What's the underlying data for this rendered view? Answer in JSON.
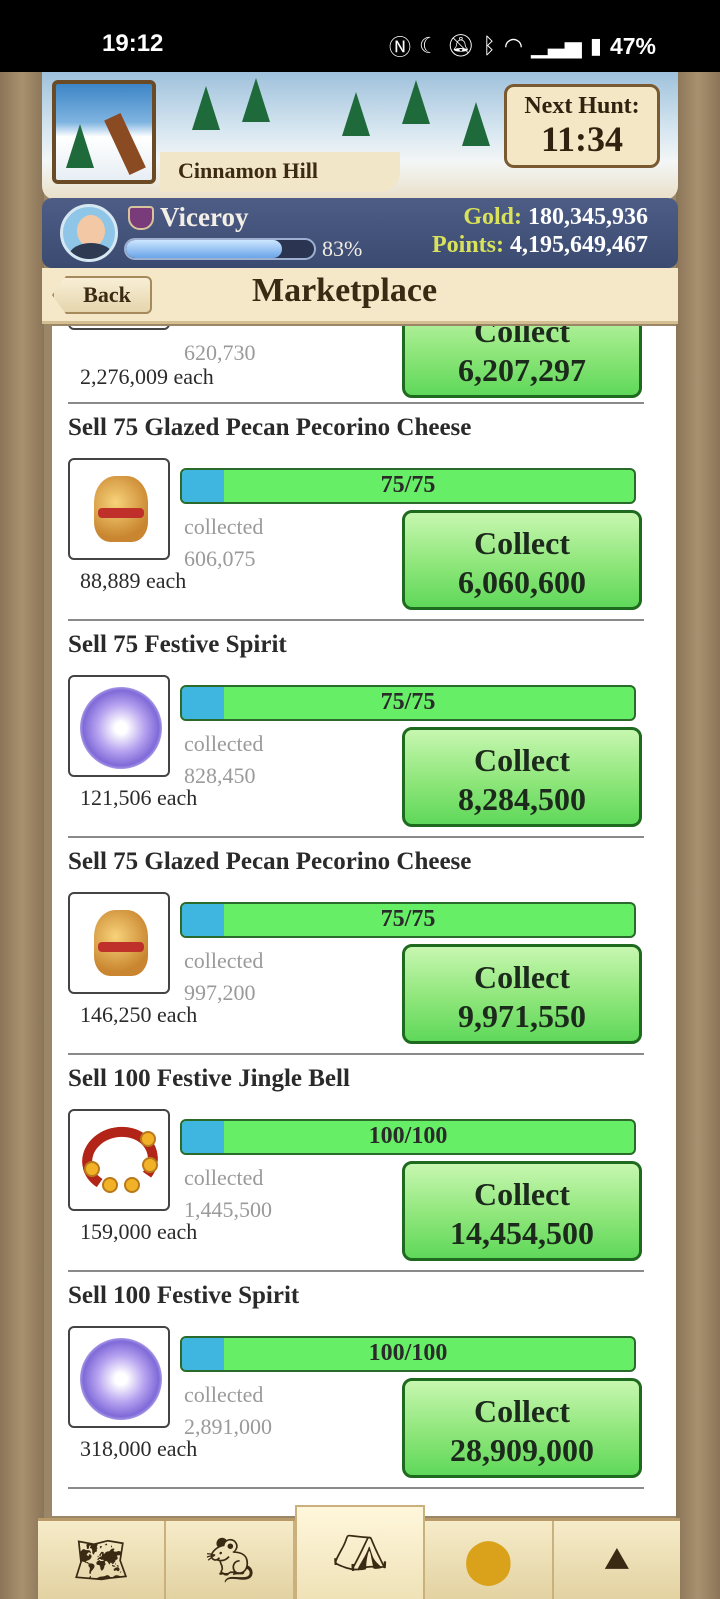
{
  "status_bar": {
    "time": "19:12",
    "icons": [
      "nfc-icon",
      "moon-icon",
      "mute-icon",
      "bluetooth-icon",
      "wifi-icon",
      "signal-icon",
      "battery-icon"
    ],
    "battery": "47%"
  },
  "header": {
    "location_name": "Cinnamon Hill",
    "next_hunt_label": "Next Hunt:",
    "next_hunt_time": "11:34"
  },
  "player": {
    "name": "Viceroy",
    "xp_percent_label": "83%",
    "xp_fraction": 0.83,
    "gold_label": "Gold:",
    "gold_value": "180,345,936",
    "points_label": "Points:",
    "points_value": "4,195,649,467"
  },
  "titlebar": {
    "back_label": "Back",
    "title": "Marketplace"
  },
  "listings": [
    {
      "title": "",
      "progress": "",
      "collected_label": "",
      "collected_amount": "620,730",
      "each": "2,276,009 each",
      "collect_label": "Collect",
      "collect_amount": "6,207,297",
      "item": "cheese-icon"
    },
    {
      "title": "Sell 75 Glazed Pecan Pecorino Cheese",
      "progress": "75/75",
      "collected_label": "collected",
      "collected_amount": "606,075",
      "each": "88,889 each",
      "collect_label": "Collect",
      "collect_amount": "6,060,600",
      "item": "cheese-icon"
    },
    {
      "title": "Sell 75 Festive Spirit",
      "progress": "75/75",
      "collected_label": "collected",
      "collected_amount": "828,450",
      "each": "121,506 each",
      "collect_label": "Collect",
      "collect_amount": "8,284,500",
      "item": "spirit-icon"
    },
    {
      "title": "Sell 75 Glazed Pecan Pecorino Cheese",
      "progress": "75/75",
      "collected_label": "collected",
      "collected_amount": "997,200",
      "each": "146,250 each",
      "collect_label": "Collect",
      "collect_amount": "9,971,550",
      "item": "cheese-icon"
    },
    {
      "title": "Sell 100 Festive Jingle Bell",
      "progress": "100/100",
      "collected_label": "collected",
      "collected_amount": "1,445,500",
      "each": "159,000 each",
      "collect_label": "Collect",
      "collect_amount": "14,454,500",
      "item": "jingle-bell-icon"
    },
    {
      "title": "Sell 100 Festive Spirit",
      "progress": "100/100",
      "collected_label": "collected",
      "collected_amount": "2,891,000",
      "each": "318,000 each",
      "collect_label": "Collect",
      "collect_amount": "28,909,000",
      "item": "spirit-icon"
    }
  ],
  "bottom_nav": [
    {
      "icon": "map-icon",
      "active": false
    },
    {
      "icon": "mouse-icon",
      "active": false
    },
    {
      "icon": "camp-tent-icon",
      "active": true
    },
    {
      "icon": "gold-coins-icon",
      "active": false
    },
    {
      "icon": "chevrons-up-icon",
      "active": false
    }
  ],
  "colors": {
    "progress_fill": "#66ee66",
    "progress_segment": "#3fb6e0",
    "collect_button": "#8ee67a",
    "gold_label": "#d9e25a"
  }
}
